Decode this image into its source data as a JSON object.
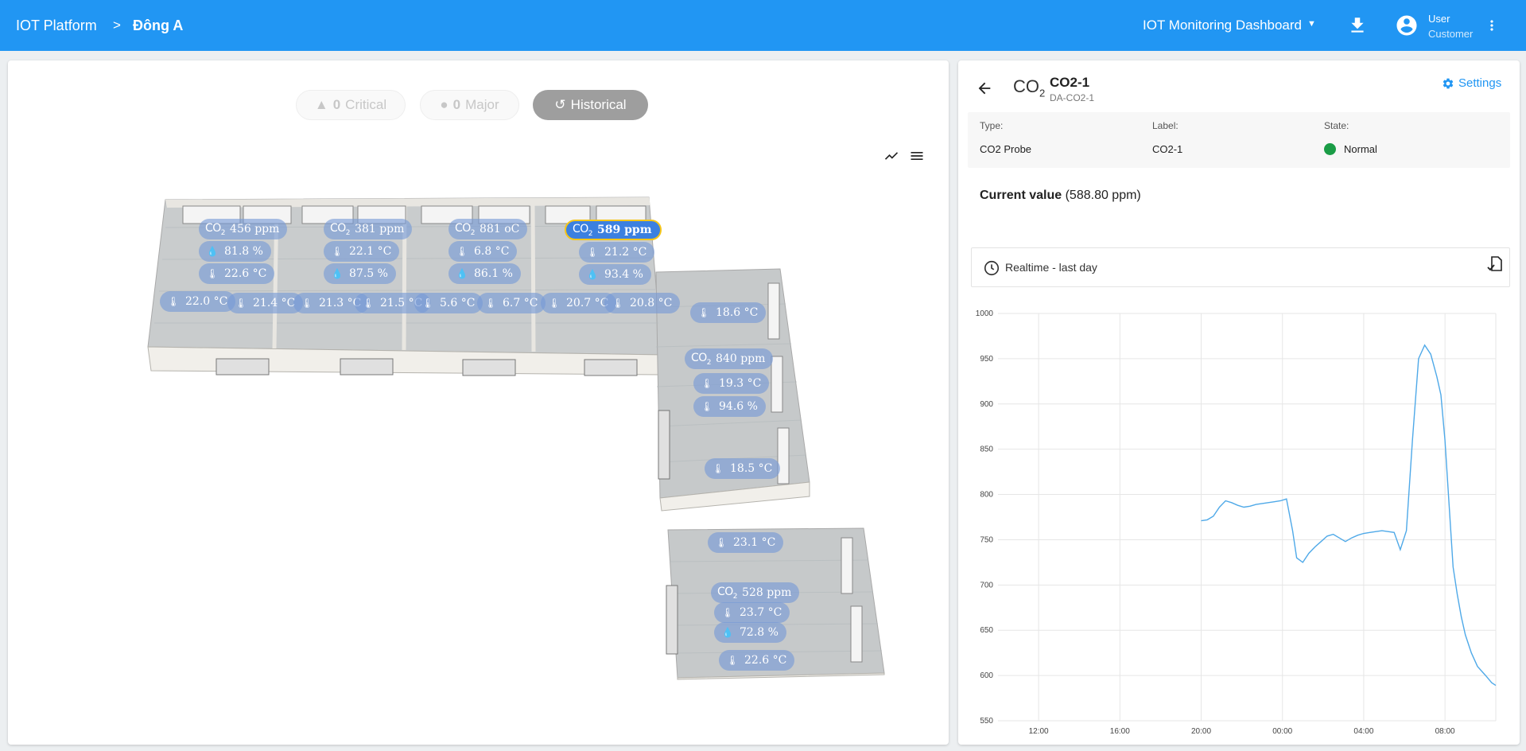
{
  "topbar": {
    "breadcrumb_root": "IOT Platform",
    "breadcrumb_separator": ">",
    "breadcrumb_current": "Đông A",
    "dashboard_select": "IOT Monitoring Dashboard",
    "user_name": "User",
    "user_role": "Customer",
    "icons": [
      "download-icon",
      "account-circle-icon",
      "more-vert-icon"
    ]
  },
  "left": {
    "title": "Đông A",
    "alarms": {
      "critical_count": "0",
      "critical_label": "Critical",
      "major_count": "0",
      "major_label": "Major",
      "historical_label": "Historical"
    },
    "sensors": [
      {
        "type": "co2",
        "value": "456 ppm"
      },
      {
        "type": "humidity",
        "value": "81.8 %"
      },
      {
        "type": "temp",
        "value": "22.6 °C"
      },
      {
        "type": "co2",
        "value": "381 ppm"
      },
      {
        "type": "temp",
        "value": "22.1 °C"
      },
      {
        "type": "humidity",
        "value": "87.5 %"
      },
      {
        "type": "co2",
        "value": "881 oC"
      },
      {
        "type": "temp",
        "value": "6.8 °C"
      },
      {
        "type": "humidity",
        "value": "86.1 %"
      },
      {
        "type": "co2",
        "value": "589 ppm",
        "active": true
      },
      {
        "type": "temp",
        "value": "21.2 °C"
      },
      {
        "type": "humidity",
        "value": "93.4 %"
      },
      {
        "type": "temp",
        "value": "22.0 °C"
      },
      {
        "type": "temp",
        "value": "21.4 °C"
      },
      {
        "type": "temp",
        "value": "21.3 °C"
      },
      {
        "type": "temp",
        "value": "21.5 °C"
      },
      {
        "type": "temp",
        "value": "5.6 °C"
      },
      {
        "type": "temp",
        "value": "6.7 °C"
      },
      {
        "type": "temp",
        "value": "20.7 °C"
      },
      {
        "type": "temp",
        "value": "20.8 °C"
      },
      {
        "type": "temp",
        "value": "18.6 °C"
      },
      {
        "type": "co2",
        "value": "840 ppm"
      },
      {
        "type": "temp",
        "value": "19.3 °C"
      },
      {
        "type": "temp",
        "value": "94.6 %"
      },
      {
        "type": "temp",
        "value": "18.5 °C"
      },
      {
        "type": "temp",
        "value": "23.1 °C"
      },
      {
        "type": "co2",
        "value": "528 ppm"
      },
      {
        "type": "temp",
        "value": "23.7 °C"
      },
      {
        "type": "humidity",
        "value": "72.8 %"
      },
      {
        "type": "temp",
        "value": "22.6 °C"
      }
    ]
  },
  "right": {
    "device_name": "CO2-1",
    "device_id": "DA-CO2-1",
    "settings_label": "Settings",
    "type_label": "Type:",
    "type_value": "CO2 Probe",
    "label_label": "Label:",
    "label_value": "CO2-1",
    "state_label": "State:",
    "state_value": "Normal",
    "state_color": "#1a9c46",
    "current_value_label": "Current value",
    "current_value": "(588.80 ppm)",
    "period_label": "Realtime - last day",
    "line_color": "#4fa9e8"
  },
  "chart_data": {
    "type": "line",
    "title": "",
    "xlabel": "",
    "ylabel": "",
    "ylim": [
      550,
      1000
    ],
    "yticks": [
      550,
      600,
      650,
      700,
      750,
      800,
      850,
      900,
      950,
      1000
    ],
    "xlim": [
      10,
      34.5
    ],
    "xticks": [
      12,
      16,
      20,
      24,
      28,
      32
    ],
    "xtick_labels": [
      "12:00",
      "16:00",
      "20:00",
      "00:00",
      "04:00",
      "08:00"
    ],
    "grid": true,
    "x_unit": "hours (24+ = next day)",
    "series": [
      {
        "x": [
          20.0,
          20.3,
          20.6,
          20.9,
          21.2,
          21.5,
          21.8,
          22.1,
          22.4,
          22.7,
          23.0,
          23.3,
          23.6,
          23.9,
          24.2,
          24.5,
          24.7,
          25.0,
          25.3,
          25.6,
          25.9,
          26.2,
          26.5,
          26.8,
          27.1,
          27.4,
          27.7,
          28.0,
          28.3,
          28.6,
          28.9,
          29.2,
          29.5,
          29.8,
          30.1,
          30.4,
          30.7,
          31.0,
          31.3,
          31.6,
          31.8,
          32.0,
          32.2,
          32.4,
          32.6,
          32.8,
          33.0,
          33.3,
          33.6,
          34.0,
          34.3,
          34.5
        ],
        "y": [
          771,
          772,
          776,
          786,
          793,
          791,
          788,
          786,
          787,
          789,
          790,
          791,
          792,
          793,
          795,
          760,
          730,
          725,
          735,
          742,
          748,
          754,
          756,
          752,
          748,
          752,
          755,
          757,
          758,
          759,
          760,
          759,
          758,
          739,
          760,
          860,
          950,
          965,
          955,
          930,
          910,
          860,
          790,
          720,
          690,
          665,
          645,
          625,
          610,
          600,
          592,
          589
        ]
      }
    ]
  }
}
